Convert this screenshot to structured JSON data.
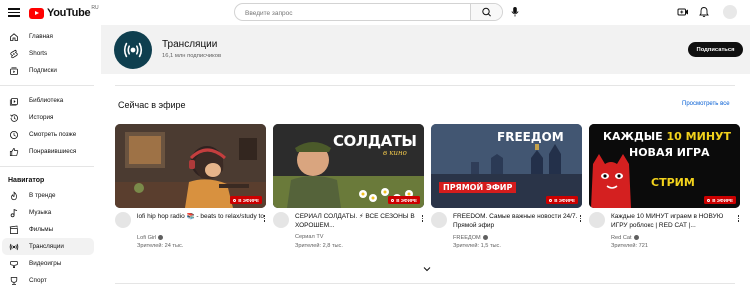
{
  "header": {
    "logo_text": "YouTube",
    "logo_country": "RU",
    "search_placeholder": "Введите запрос",
    "icons": [
      "menu-icon",
      "search-icon",
      "mic-icon",
      "create-video-icon",
      "bell-icon"
    ]
  },
  "sidebar": {
    "group1": [
      {
        "label": "Главная",
        "icon": "home-icon"
      },
      {
        "label": "Shorts",
        "icon": "shorts-icon"
      },
      {
        "label": "Подписки",
        "icon": "subscriptions-icon"
      }
    ],
    "group2": [
      {
        "label": "Библиотека",
        "icon": "library-icon"
      },
      {
        "label": "История",
        "icon": "history-icon"
      },
      {
        "label": "Смотреть позже",
        "icon": "watch-later-icon"
      },
      {
        "label": "Понравившиеся",
        "icon": "like-icon"
      }
    ],
    "navigator_title": "Навигатор",
    "group3": [
      {
        "label": "В тренде",
        "icon": "trending-icon"
      },
      {
        "label": "Музыка",
        "icon": "music-icon"
      },
      {
        "label": "Фильмы",
        "icon": "film-icon"
      },
      {
        "label": "Трансляции",
        "icon": "live-icon",
        "active": true
      },
      {
        "label": "Видеоигры",
        "icon": "gaming-icon"
      },
      {
        "label": "Спорт",
        "icon": "sport-icon"
      }
    ]
  },
  "channel": {
    "name": "Трансляции",
    "subscribers": "16,1 млн подписчиков",
    "subscribe_label": "Подписаться"
  },
  "shelf": {
    "title": "Сейчас в эфире",
    "more_label": "Просмотреть все",
    "live_label": "В ЭФИРЕ",
    "videos": [
      {
        "title": "lofi hip hop radio 📚 - beats to relax/study to",
        "channel": "Lofi Girl",
        "views": "Зрителей: 24 тыс.",
        "thumb_bg": "#4a3a2e"
      },
      {
        "title": "СЕРИАЛ СОЛДАТЫ. ⚡ ВСЕ СЕЗОНЫ В ХОРОШЕМ...",
        "channel": "Сериал TV",
        "views": "Зрителей: 2,8 тыс.",
        "thumb_text": "СОЛДАТЫ",
        "thumb_subtext": "в кино",
        "thumb_bg": "#2e2e2e"
      },
      {
        "title": "FREEDOM. Самые важные новости 24/7. Прямой эфир",
        "channel": "FREEДOM",
        "views": "Зрителей: 1,5 тыс.",
        "thumb_text": "FREEДOM",
        "thumb_subtext": "ПРЯМОЙ ЭФИР",
        "thumb_bg": "#3b4a63"
      },
      {
        "title": "Каждые 10 МИНУТ играем в НОВУЮ ИГРУ роблокс | RED CAT |...",
        "channel": "Red Cat",
        "views": "Зрителей: 721",
        "thumb_text_1": "КАЖДЫЕ",
        "thumb_text_2": "10 МИНУТ",
        "thumb_text_3": "НОВАЯ ИГРА",
        "thumb_text_4": "СТРИМ",
        "thumb_bg": "#0a0a0a"
      }
    ]
  },
  "colors": {
    "brand_red": "#ff0000",
    "live_red": "#cc0000",
    "link_blue": "#065fd4",
    "text_primary": "#0f0f0f",
    "text_secondary": "#606060",
    "banner_bg": "#f2f2f2"
  }
}
